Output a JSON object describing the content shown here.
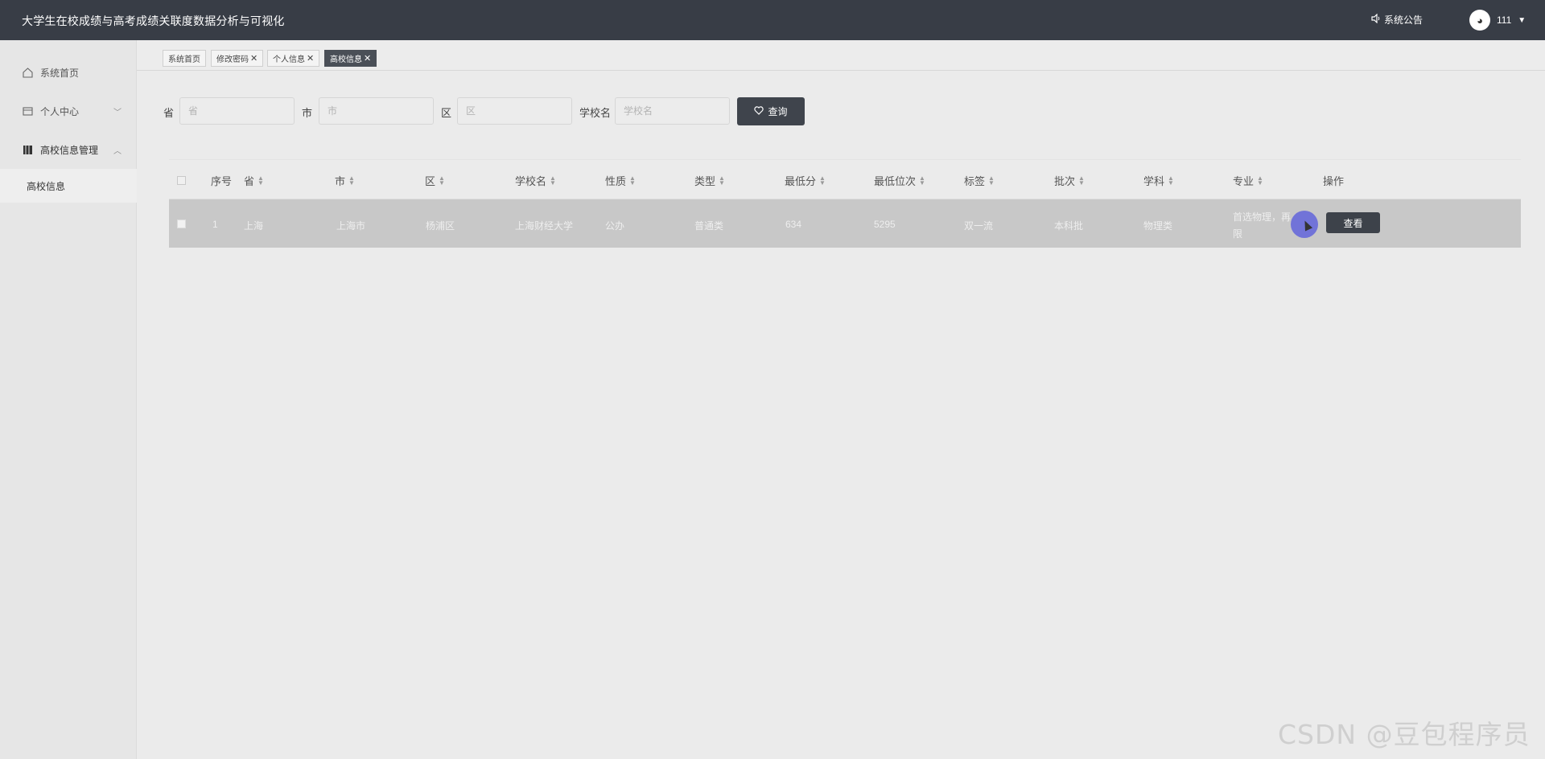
{
  "header": {
    "title": "大学生在校成绩与高考成绩关联度数据分析与可视化",
    "notice_label": "系统公告",
    "username": "111"
  },
  "sidebar": {
    "items": [
      {
        "label": "系统首页",
        "icon": "home-icon"
      },
      {
        "label": "个人中心",
        "icon": "card-icon"
      },
      {
        "label": "高校信息管理",
        "icon": "book-icon"
      }
    ],
    "sub_item": "高校信息"
  },
  "tabs": [
    {
      "label": "系统首页"
    },
    {
      "label": "修改密码"
    },
    {
      "label": "个人信息"
    },
    {
      "label": "高校信息"
    }
  ],
  "search": {
    "province_label": "省",
    "province_placeholder": "省",
    "city_label": "市",
    "city_placeholder": "市",
    "district_label": "区",
    "district_placeholder": "区",
    "school_label": "学校名",
    "school_placeholder": "学校名",
    "query_button": "查询"
  },
  "table": {
    "headers": [
      "序号",
      "省",
      "市",
      "区",
      "学校名",
      "性质",
      "类型",
      "最低分",
      "最低位次",
      "标签",
      "批次",
      "学科",
      "专业",
      "操作"
    ],
    "rows": [
      {
        "index": "1",
        "province": "上海",
        "city": "上海市",
        "district": "杨浦区",
        "school": "上海财经大学",
        "nature": "公办",
        "type": "普通类",
        "min_score": "634",
        "min_rank": "5295",
        "tag": "双一流",
        "batch": "本科批",
        "subject": "物理类",
        "major_line1": "首选物理，再",
        "major_line2": "限",
        "action": "查看"
      }
    ]
  },
  "watermark": "CSDN @豆包程序员",
  "colors": {
    "header_bg": "#383d46",
    "button_bg": "#3f444c",
    "row_highlight": "#c8c8c8",
    "cursor_dot": "#7173d8"
  }
}
